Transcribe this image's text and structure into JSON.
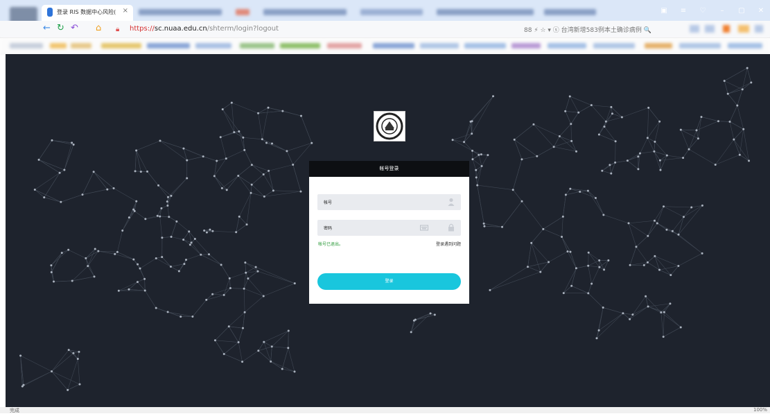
{
  "browser": {
    "active_tab": {
      "title": "登录 RIS 数据中心风险(",
      "close": "×"
    },
    "window_controls": [
      "▣",
      "≡",
      "♡",
      "–",
      "▢",
      "✕"
    ],
    "url": {
      "scheme": "https://",
      "host": "sc.nuaa.edu.cn",
      "path": "/shterm/login?logout"
    },
    "right_tools": "88 ⚡ ☆ ▾  ⓢ  台湾新增583例本土确诊病例  🔍",
    "status_left": "完成",
    "status_right": "100%"
  },
  "page": {
    "login_header": "帐号登录",
    "account_label": "帐号",
    "password_label": "密码",
    "logout_message": "帐号已退出。",
    "trouble_link": "登录遇到问题",
    "login_button": "登录"
  },
  "colors": {
    "background": "#1e232d",
    "button": "#19c6dd",
    "message": "#2c9a3a"
  }
}
